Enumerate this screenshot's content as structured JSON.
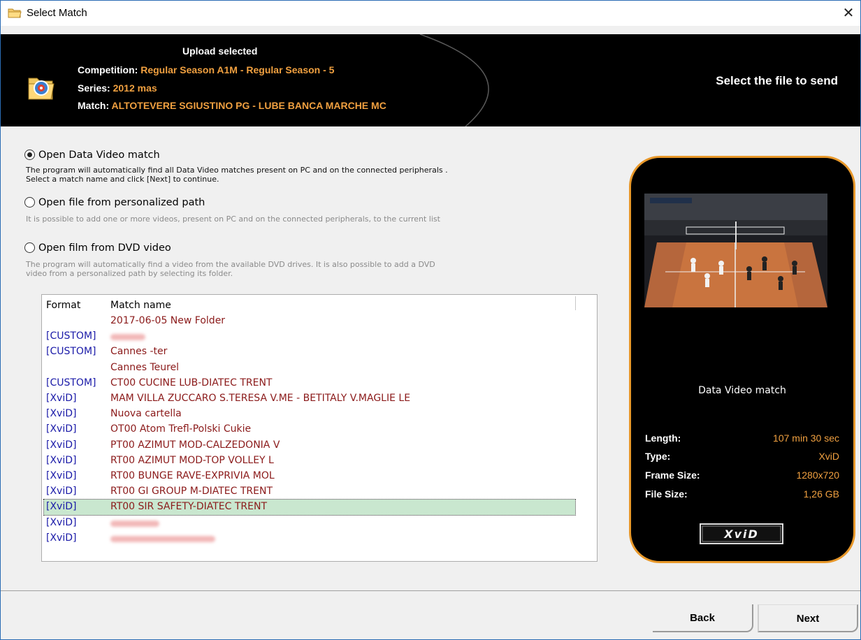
{
  "window": {
    "title": "Select Match",
    "close_glyph": "✕"
  },
  "header": {
    "heading": "Upload selected",
    "competition_label": "Competition:",
    "competition_value": "Regular Season A1M - Regular Season - 5",
    "series_label": "Series:",
    "series_value": "2012 mas",
    "match_label": "Match:",
    "match_value": "ALTOTEVERE SGIUSTINO PG - LUBE BANCA MARCHE MC",
    "right_caption": "Select the file to send"
  },
  "options": [
    {
      "label": "Open Data Video match",
      "selected": true,
      "desc_line1": "The program will automatically find all Data Video matches present on PC and on the connected peripherals .",
      "desc_line2": "Select a match name and click [Next] to continue."
    },
    {
      "label": "Open file from personalized path",
      "selected": false,
      "desc_line1": "It is possible to add  one or more videos, present on PC and on the connected peripherals, to the current list"
    },
    {
      "label": "Open film from DVD video",
      "selected": false,
      "desc_line1": "The program will automatically find a video from the available DVD drives. It is also possible to add a DVD",
      "desc_line2": "video from a personalized path by selecting its folder."
    }
  ],
  "table": {
    "col_format": "Format",
    "col_name": "Match name",
    "rows": [
      {
        "format": "",
        "name": "2017-06-05 New Folder"
      },
      {
        "format": "[CUSTOM]",
        "name": "",
        "redacted": true
      },
      {
        "format": "[CUSTOM]",
        "name": "Cannes -ter"
      },
      {
        "format": "",
        "name": "Cannes Teurel"
      },
      {
        "format": "[CUSTOM]",
        "name": "CT00 CUCINE LUB-DIATEC TRENT"
      },
      {
        "format": "[XviD]",
        "name": "MAM VILLA ZUCCARO S.TERESA V.ME - BETITALY V.MAGLIE LE"
      },
      {
        "format": "[XviD]",
        "name": "Nuova cartella"
      },
      {
        "format": "[XviD]",
        "name": "OT00 Atom Trefl-Polski Cukie"
      },
      {
        "format": "[XviD]",
        "name": "PT00 AZIMUT MOD-CALZEDONIA V"
      },
      {
        "format": "[XviD]",
        "name": "RT00 AZIMUT MOD-TOP VOLLEY L"
      },
      {
        "format": "[XviD]",
        "name": "RT00 BUNGE RAVE-EXPRIVIA MOL"
      },
      {
        "format": "[XviD]",
        "name": "RT00 GI GROUP M-DIATEC TRENT"
      },
      {
        "format": "[XviD]",
        "name": "RT00 SIR SAFETY-DIATEC TRENT",
        "selected": true
      },
      {
        "format": "[XviD]",
        "name": "",
        "redacted": true
      },
      {
        "format": "[XviD]",
        "name": "",
        "redacted": true
      }
    ]
  },
  "preview": {
    "title": "Data Video match",
    "length_label": "Length:",
    "length_value": "107 min 30 sec",
    "type_label": "Type:",
    "type_value": "XviD",
    "frame_label": "Frame Size:",
    "frame_value": "1280x720",
    "filesize_label": "File Size:",
    "filesize_value": "1,26 GB",
    "badge": "XviD"
  },
  "buttons": {
    "back": "Back",
    "next": "Next"
  },
  "colors": {
    "accent_orange": "#f0a040",
    "format_blue": "#1a1aa8",
    "name_red": "#8b1a1a",
    "selected_row": "#c9e7cf",
    "frame_border": "#e8982a"
  }
}
